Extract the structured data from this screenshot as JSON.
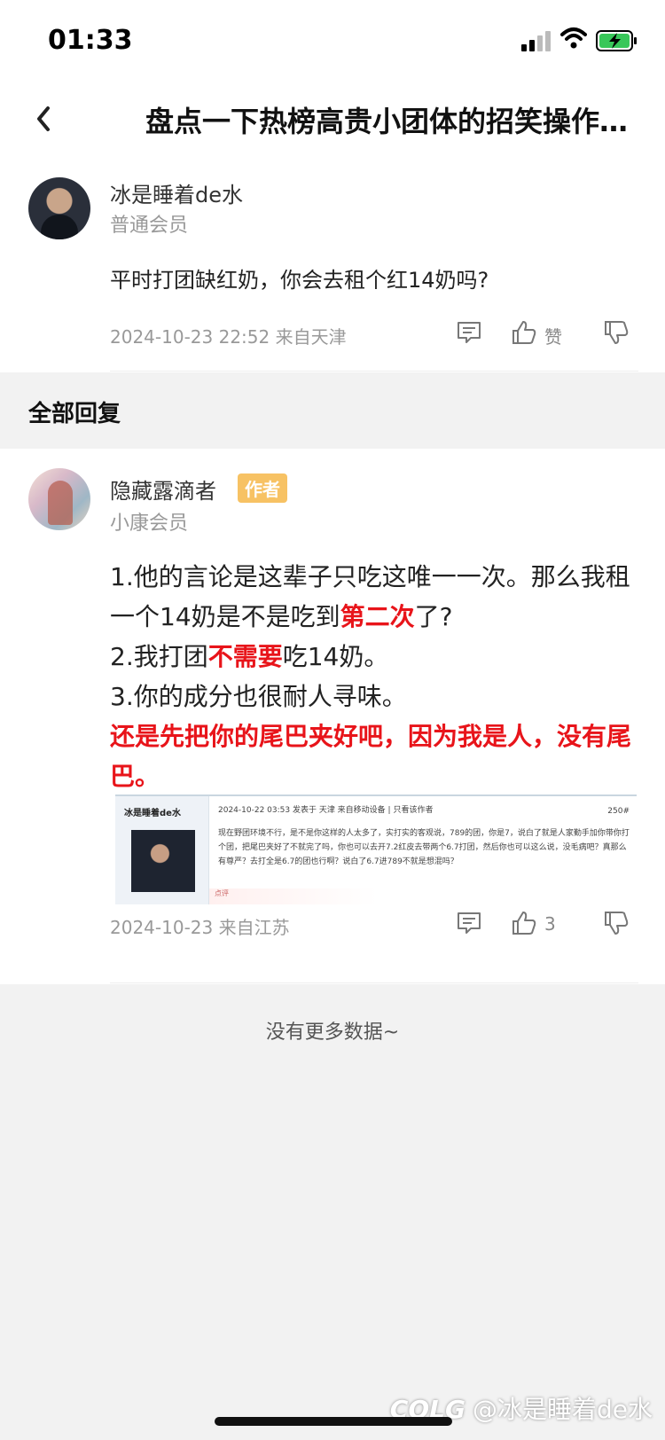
{
  "status_bar": {
    "time": "01:33"
  },
  "nav": {
    "title": "盘点一下热榜高贵小团体的招笑操作…"
  },
  "post": {
    "username": "冰是睡着de水",
    "level": "普通会员",
    "text": "平时打团缺红奶，你会去租个红14奶吗?",
    "meta": "2024-10-23 22:52  来自天津",
    "like_label": "赞"
  },
  "replies_header": "全部回复",
  "reply": {
    "username": "隐藏露滴者",
    "badge": "作者",
    "level": "小康会员",
    "lines": {
      "l1a": "1.他的言论是这辈子只吃这唯一一次。那么我租一个14奶是不是吃到",
      "l1b": "第二次",
      "l1c": "了?",
      "l2a": "2.我打团",
      "l2b": "不需要",
      "l2c": "吃14奶。",
      "l3": "3.你的成分也很耐人寻味。",
      "l4": "还是先把你的尾巴夹好吧，因为我是人，没有尾巴。"
    },
    "quote": {
      "name": "冰是睡着de水",
      "header": "2024-10-22 03:53  发表于 天津  来自移动设备  |  只看该作者",
      "count": "250#",
      "text": "现在野团环境不行，是不是你这样的人太多了，实打实的客观说，789的团，你是7，说白了就是人家勤手加你带你打个团，把尾巴夹好了不就完了吗，你也可以去开7.2红皮去带两个6.7打团，然后你也可以这么说，没毛病吧？真那么有尊严？去打全是6.7的团也行啊？说白了6.7进789不就是想混吗？",
      "footer": "点评"
    },
    "meta": "2024-10-23 来自江苏",
    "like_count": "3"
  },
  "footer": {
    "no_more": "没有更多数据~"
  },
  "watermark": {
    "logo": "COLG",
    "text": "@冰是睡着de水"
  },
  "colors": {
    "accent_red": "#e8141a",
    "badge": "#f7c264"
  }
}
